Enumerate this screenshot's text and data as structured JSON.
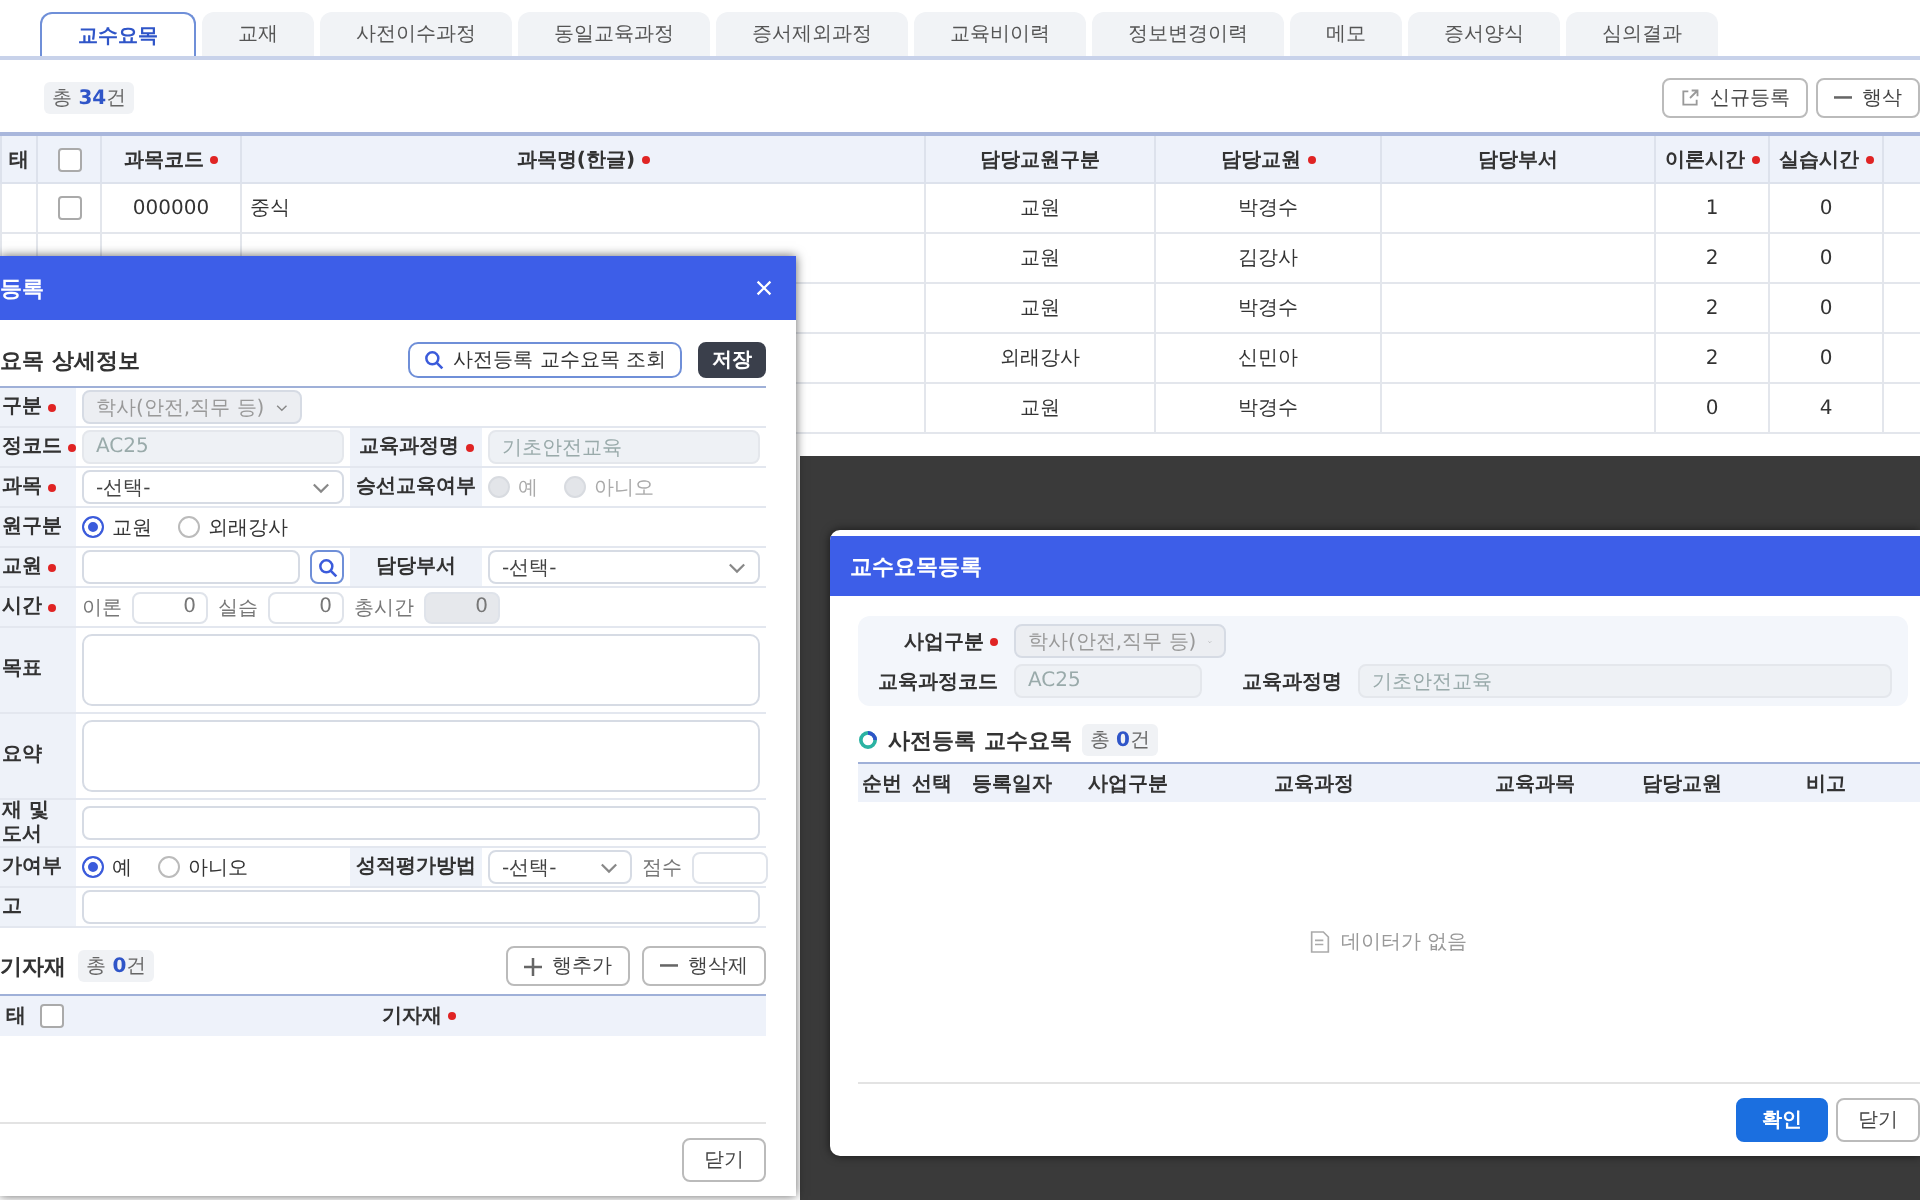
{
  "tabs": [
    {
      "label": "교수요목",
      "selected": true
    },
    {
      "label": "교재",
      "selected": false
    },
    {
      "label": "사전이수과정",
      "selected": false
    },
    {
      "label": "동일교육과정",
      "selected": false
    },
    {
      "label": "증서제외과정",
      "selected": false
    },
    {
      "label": "교육비이력",
      "selected": false
    },
    {
      "label": "정보변경이력",
      "selected": false
    },
    {
      "label": "메모",
      "selected": false
    },
    {
      "label": "증서양식",
      "selected": false
    },
    {
      "label": "심의결과",
      "selected": false
    }
  ],
  "list": {
    "count": "총 **34**건",
    "buttons": [
      {
        "kind": "new",
        "label": "신규등록"
      },
      {
        "kind": "remove",
        "label": "행삭"
      }
    ]
  },
  "table": {
    "columns": [
      {
        "label": "태"
      },
      {
        "kind": "checkbox",
        "checked": false
      },
      {
        "label": "과목코드",
        "required": true
      },
      {
        "label": "과목명(한글)",
        "required": true
      },
      {
        "label": "담당교원구분"
      },
      {
        "label": "담당교원",
        "required": true
      },
      {
        "label": "담당부서"
      },
      {
        "label": "이론시간",
        "required": true
      },
      {
        "label": "실습시간",
        "required": true
      }
    ],
    "rows": [
      {
        "checked": false,
        "code": "000000",
        "name": "중식",
        "teacher_type": "교원",
        "teacher": "박경수",
        "theory": "1",
        "practice": "0"
      },
      {
        "teacher_type": "교원",
        "teacher": "김강사",
        "theory": "2",
        "practice": "0"
      },
      {
        "teacher_type": "교원",
        "teacher": "박경수",
        "theory": "2",
        "practice": "0"
      },
      {
        "teacher_type": "외래강사",
        "teacher": "신민아",
        "theory": "2",
        "practice": "0"
      },
      {
        "teacher_type": "교원",
        "teacher": "박경수",
        "theory": "0",
        "practice": "4"
      }
    ]
  },
  "detail_dialog": {
    "title": "등록",
    "section_title": "요목 상세정보",
    "lookup_button": "사전등록 교수요목 조회",
    "save_button": "저장",
    "form": [
      {
        "cells": [
          {
            "label": "구분",
            "required": true,
            "controls": [
              {
                "kind": "select",
                "value": "학사(안전,직무 등)",
                "disabled": true
              }
            ]
          }
        ]
      },
      {
        "cells": [
          {
            "label": "정코드",
            "required": true,
            "controls": [
              {
                "kind": "input",
                "value": "AC25",
                "disabled": true
              }
            ]
          },
          {
            "label": "교육과정명",
            "required": true,
            "controls": [
              {
                "kind": "input",
                "value": "기초안전교육",
                "disabled": true
              }
            ]
          }
        ]
      },
      {
        "cells": [
          {
            "label": "과목",
            "required": true,
            "controls": [
              {
                "kind": "select",
                "value": "-선택-",
                "disabled": false
              }
            ]
          },
          {
            "label": "승선교육여부",
            "controls": [
              {
                "kind": "radio",
                "disabled": true,
                "options": [
                  {
                    "label": "예",
                    "selected": false
                  },
                  {
                    "label": "아니오",
                    "selected": false
                  }
                ]
              }
            ]
          }
        ]
      },
      {
        "cells": [
          {
            "label": "원구분",
            "controls": [
              {
                "kind": "radio",
                "disabled": false,
                "options": [
                  {
                    "label": "교원",
                    "selected": true
                  },
                  {
                    "label": "외래강사",
                    "selected": false
                  }
                ]
              }
            ]
          }
        ]
      },
      {
        "cells": [
          {
            "label": "교원",
            "required": true,
            "controls": [
              {
                "kind": "search",
                "disabled": false
              }
            ]
          },
          {
            "label": "담당부서",
            "controls": [
              {
                "kind": "select",
                "value": "-선택-",
                "disabled": false
              }
            ]
          }
        ]
      },
      {
        "cells": [
          {
            "label": "시간",
            "required": true,
            "controls": [
              {
                "kind": "number",
                "label": "이론",
                "value": "0",
                "disabled": false
              },
              {
                "kind": "number",
                "label": "실습",
                "value": "0",
                "disabled": false
              },
              {
                "kind": "number",
                "label": "총시간",
                "value": "0",
                "disabled": true
              }
            ]
          }
        ]
      },
      {
        "cells": [
          {
            "label": "목표",
            "controls": [
              {
                "kind": "textarea"
              }
            ]
          }
        ]
      },
      {
        "cells": [
          {
            "label": "요약",
            "controls": [
              {
                "kind": "textarea"
              }
            ]
          }
        ]
      },
      {
        "cells": [
          {
            "label": "재 및 도서",
            "controls": [
              {
                "kind": "input",
                "disabled": false
              }
            ]
          }
        ]
      },
      {
        "cells": [
          {
            "label": "가여부",
            "controls": [
              {
                "kind": "radio",
                "disabled": false,
                "options": [
                  {
                    "label": "예",
                    "selected": true
                  },
                  {
                    "label": "아니오",
                    "selected": false
                  }
                ]
              }
            ]
          },
          {
            "label": "성적평가방법",
            "controls": [
              {
                "kind": "select",
                "value": "-선택-",
                "disabled": false
              },
              {
                "kind": "number",
                "label": "점수",
                "disabled": false
              }
            ]
          }
        ]
      },
      {
        "cells": [
          {
            "label": "고",
            "controls": [
              {
                "kind": "input",
                "disabled": false
              }
            ]
          }
        ]
      }
    ],
    "equipment": {
      "title": "기자재",
      "count": "총 **0**건",
      "buttons": [
        {
          "kind": "add",
          "label": "행추가"
        },
        {
          "kind": "remove",
          "label": "행삭제"
        }
      ],
      "columns": [
        {
          "label": "태"
        },
        {
          "kind": "checkbox",
          "checked": false
        },
        {
          "label": "기자재",
          "required": true
        }
      ]
    },
    "close_button": "닫기"
  },
  "lookup_dialog": {
    "title": "교수요목등록",
    "filters": [
      {
        "label": "사업구분",
        "required": true,
        "kind": "select",
        "value": "학사(안전,직무 등)",
        "disabled": true
      },
      {
        "label": "교육과정코드",
        "kind": "input",
        "value": "AC25",
        "disabled": true
      },
      {
        "label": "교육과정명",
        "kind": "input",
        "value": "기초안전교육",
        "disabled": true
      }
    ],
    "section_title": "사전등록 교수요목",
    "count": "총 **0**건",
    "columns": [
      "순번",
      "선택",
      "등록일자",
      "사업구분",
      "교육과정",
      "교육과목",
      "담당교원",
      "비고"
    ],
    "empty_message": "데이터가 없음",
    "buttons": [
      {
        "kind": "primary",
        "label": "확인"
      },
      {
        "kind": "secondary",
        "label": "닫기"
      }
    ]
  }
}
